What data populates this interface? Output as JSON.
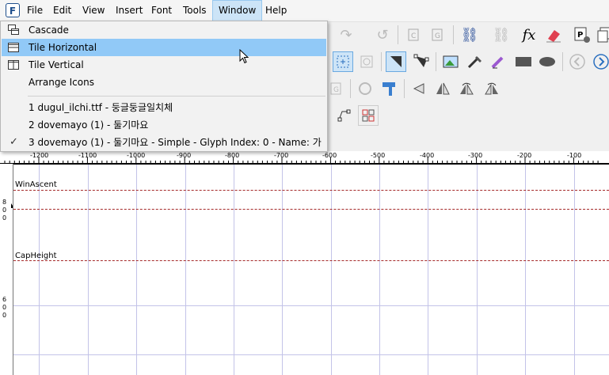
{
  "menubar": {
    "items": [
      "File",
      "Edit",
      "View",
      "Insert",
      "Font",
      "Tools",
      "Window",
      "Help"
    ]
  },
  "window_menu": {
    "items": [
      {
        "label": "Cascade",
        "icon": "cascade-icon"
      },
      {
        "label": "Tile Horizontal",
        "icon": "tile-horizontal-icon",
        "highlighted": true
      },
      {
        "label": "Tile Vertical",
        "icon": "tile-vertical-icon"
      },
      {
        "label": "Arrange Icons",
        "icon": ""
      }
    ],
    "windows": [
      {
        "label": "1 dugul_ilchi.ttf - 둥글둥글일치체",
        "checked": false
      },
      {
        "label": "2 dovemayo (1) - 둘기마요",
        "checked": false
      },
      {
        "label": "3 dovemayo (1) - 둘기마요 - Simple - Glyph Index: 0 - Name: 가",
        "checked": true
      }
    ]
  },
  "ruler": {
    "labels": [
      "-1200",
      "-1100",
      "-1000",
      "-900",
      "-800",
      "-700",
      "-600",
      "-500",
      "-400",
      "-300",
      "-200",
      "-100"
    ]
  },
  "metrics": {
    "win_ascent": "WinAscent",
    "cap_height": "CapHeight"
  },
  "left_ruler": {
    "top_digits": [
      "8",
      "0",
      "0"
    ],
    "bottom_digits": [
      "6",
      "0",
      "0"
    ]
  },
  "toolbar": {
    "fx_label": "fx",
    "right_icons": [
      "font-properties-icon",
      "copy-icon"
    ]
  },
  "colors": {
    "menu_highlight": "#91c9f7",
    "guide_line": "#a52a2a",
    "grid_line": "#c3c3e8"
  }
}
